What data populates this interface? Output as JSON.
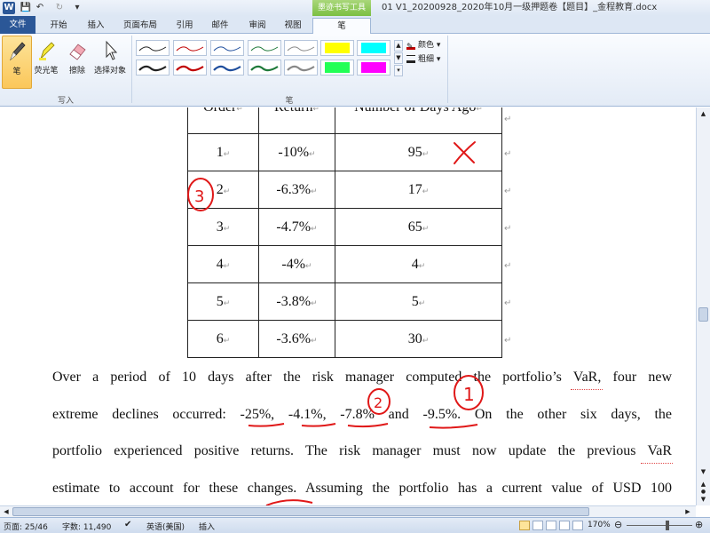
{
  "titlebar": {
    "word_icon": "W",
    "contextual_tab_group": "墨迹书写工具",
    "document_title": "01 V1_20200928_2020年10月一级押题卷【题目】_金程教育.docx"
  },
  "tabs": [
    "文件",
    "开始",
    "插入",
    "页面布局",
    "引用",
    "邮件",
    "审阅",
    "视图",
    "笔"
  ],
  "ribbon": {
    "tools": [
      {
        "label": "笔",
        "icon": "pen-icon"
      },
      {
        "label": "荧光笔",
        "icon": "highlighter-icon"
      },
      {
        "label": "擦除",
        "icon": "eraser-icon"
      },
      {
        "label": "选择对象",
        "icon": "select-cursor-icon"
      }
    ],
    "group_write_label": "写入",
    "group_pens_label": "笔",
    "color_label": "颜色",
    "thickness_label": "粗细",
    "pen_colors": [
      "#222222",
      "#c00000",
      "#1f4e9d",
      "#1f7a3a",
      "#222222",
      "#c00000",
      "#1f4e9d",
      "#1f7a3a"
    ],
    "highlighter_colors": [
      "#ffff00",
      "#00ffff",
      "#00ff44",
      "#ff00ff"
    ]
  },
  "table": {
    "headers": [
      "Order",
      "Return",
      "Number of Days Ago"
    ],
    "rows": [
      [
        "1",
        "-10%",
        "95"
      ],
      [
        "2",
        "-6.3%",
        "17"
      ],
      [
        "3",
        "-4.7%",
        "65"
      ],
      [
        "4",
        "-4%",
        "4"
      ],
      [
        "5",
        "-3.8%",
        "5"
      ],
      [
        "6",
        "-3.6%",
        "30"
      ]
    ]
  },
  "paragraph": {
    "line1": "Over a period of 10 days after the risk manager computed the portfolio’s VaR, four new",
    "line2_a": "extreme declines occurred: ",
    "v1": "-25%",
    "sep1": ", ",
    "v2": "-4.1%",
    "sep2": ", ",
    "v3": "-7.8%",
    "sep3": " and ",
    "v4": "-9.5%",
    "line2_b": ". On the other six days, the",
    "line3": "portfolio experienced positive returns. The risk manager must now update the previous VaR",
    "line4": "estimate to account for these changes. Assuming the portfolio has a current value of USD 100"
  },
  "annotations": {
    "circle_row2": "3",
    "circle_v3": "2",
    "circle_v4": "1"
  },
  "status": {
    "page": "页面: 25/46",
    "words": "字数: 11,490",
    "language": "英语(美国)",
    "mode": "插入",
    "zoom": "170%"
  }
}
